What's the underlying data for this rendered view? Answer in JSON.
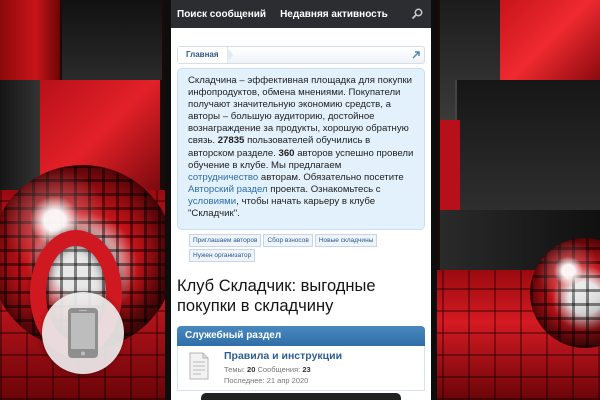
{
  "topnav": {
    "search_messages": "Поиск сообщений",
    "recent_activity": "Недавняя активность"
  },
  "breadcrumb": {
    "home": "Главная"
  },
  "notice": {
    "p1": "Складчина – эффективная площадка для покупки инфопродуктов, обмена мнениями. Покупатели получают значительную экономию средств, а авторы – большую аудиторию, достойное вознаграждение за продукты, хорошую обратную связь. ",
    "users_count": "27835",
    "p2": " пользователей обучились в авторском разделе. ",
    "authors_count": "360",
    "p3": " авторов успешно провели обучение в клубе. Мы предлагаем ",
    "link_cooperation": "сотрудничество",
    "p4": " авторам. Обязательно посетите ",
    "link_author_section": "Авторский раздел",
    "p5": " проекта. Ознакомьтесь с ",
    "link_terms": "условиями",
    "p6": ", чтобы начать карьеру в клубе \"Складчик\"."
  },
  "tabs": [
    "Приглашаем авторов",
    "Сбор взносов",
    "Новые складчины",
    "Нужен организатор"
  ],
  "site_title": "Клуб Складчик: выгодные покупки в складчину",
  "section": {
    "title": "Служебный раздел"
  },
  "forum": {
    "title": "Правила и инструкции",
    "topics_label": "Темы: ",
    "topics": "20",
    "messages_label": " Сообщения: ",
    "messages": "23",
    "last_label": "Последнее: ",
    "last_date": "21 апр 2020"
  },
  "colors": {
    "accent_red": "#d01820",
    "nav_bg": "#2b2d31",
    "section_blue": "#2f6ea8",
    "link_blue": "#2d6da8"
  },
  "icons": {
    "search": "search-icon",
    "jump": "jump-icon",
    "forum": "document-icon",
    "mobile": "mobile-phone-icon"
  }
}
